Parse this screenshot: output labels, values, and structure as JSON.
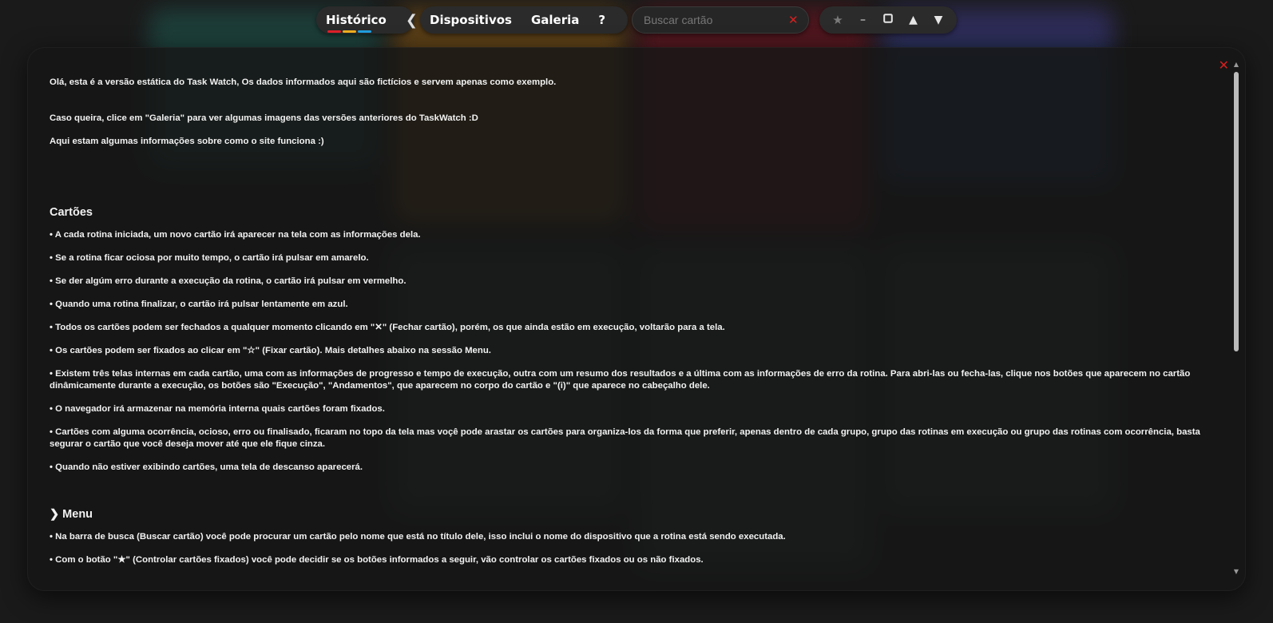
{
  "toolbar": {
    "history_label": "Histórico",
    "collapse_icon": "❮",
    "nav": [
      {
        "label": "Dispositivos"
      },
      {
        "label": "Galeria"
      },
      {
        "label": "?"
      }
    ],
    "theme_icon": "moon-icon",
    "search_placeholder": "Buscar cartão",
    "search_value": "",
    "search_clear": "✕",
    "controls": {
      "star": "★",
      "minimize": "–",
      "restore": "▢",
      "up": "▲",
      "down": "▼"
    }
  },
  "modal": {
    "close": "✕",
    "intro": [
      "Olá, esta é a versão estática do Task Watch, Os dados informados aqui são fictícios e servem apenas como exemplo.",
      "Caso queira, clice em \"Galeria\" para ver algumas imagens das versões anteriores do TaskWatch :D",
      "Aqui estam algumas informações sobre como o site funciona :)"
    ],
    "cards_heading": "Cartões",
    "cards_items": [
      "• A cada rotina iniciada, um novo cartão irá aparecer na tela com as informações dela.",
      "• Se a rotina ficar ociosa por muito tempo, o cartão irá pulsar em amarelo.",
      "• Se der algúm erro durante a execução da rotina, o cartão irá pulsar em vermelho.",
      "• Quando uma rotina finalizar, o cartão irá pulsar lentamente em azul.",
      "• Todos os cartões podem ser fechados a qualquer momento clicando em \"✕\" (Fechar cartão), porém, os que ainda estão em execução, voltarão para a tela.",
      "• Os cartões podem ser fixados ao clicar em \"☆\" (Fixar cartão). Mais detalhes abaixo na sessão Menu.",
      "• Existem três telas internas em cada cartão, uma com as informações de progresso e tempo de execução, outra com um resumo dos resultados e a última com as informações de erro da rotina. Para abri-las ou fecha-las, clique nos botões que aparecem no cartão dinâmicamente durante a execução, os botões são \"Execução\", \"Andamentos\", que aparecem no corpo do cartão e \"(i)\" que aparece no cabeçalho dele.",
      "• O navegador irá armazenar na memória interna quais cartões foram fixados.",
      "• Cartões com alguma ocorrência, ocioso, erro ou finalisado, ficaram no topo da tela mas voçê pode arastar os cartões para organiza-los da forma que preferir, apenas dentro de cada grupo, grupo das rotinas em execução ou grupo das rotinas com ocorrência, basta segurar o cartão que você deseja mover até que ele fique cinza.",
      "• Quando não estiver exibindo cartões, uma tela de descanso aparecerá."
    ],
    "menu_heading": "❯ Menu",
    "menu_items": [
      "• Na barra de busca (Buscar cartão) você pode procurar um cartão pelo nome que está no título dele, isso inclui o nome do dispositivo que a rotina está sendo executada.",
      "• Com o botão \"★\" (Controlar cartões fixados) você pode decidir se os botões informados a seguir, vão controlar os cartões fixados ou os não fixados."
    ]
  },
  "colors": {
    "accent_red": "#d42020",
    "stripe_red": "#e0202a",
    "stripe_yellow": "#f0b020",
    "stripe_blue": "#20a0e0"
  }
}
